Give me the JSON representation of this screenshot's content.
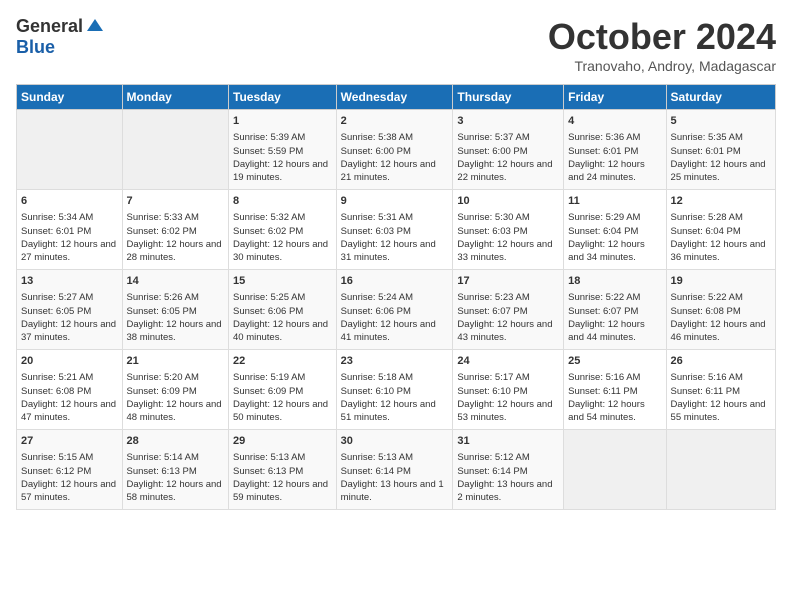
{
  "header": {
    "logo_general": "General",
    "logo_blue": "Blue",
    "month_title": "October 2024",
    "location": "Tranovaho, Androy, Madagascar"
  },
  "days_of_week": [
    "Sunday",
    "Monday",
    "Tuesday",
    "Wednesday",
    "Thursday",
    "Friday",
    "Saturday"
  ],
  "weeks": [
    [
      {
        "day": "",
        "sunrise": "",
        "sunset": "",
        "daylight": ""
      },
      {
        "day": "",
        "sunrise": "",
        "sunset": "",
        "daylight": ""
      },
      {
        "day": "1",
        "sunrise": "Sunrise: 5:39 AM",
        "sunset": "Sunset: 5:59 PM",
        "daylight": "Daylight: 12 hours and 19 minutes."
      },
      {
        "day": "2",
        "sunrise": "Sunrise: 5:38 AM",
        "sunset": "Sunset: 6:00 PM",
        "daylight": "Daylight: 12 hours and 21 minutes."
      },
      {
        "day": "3",
        "sunrise": "Sunrise: 5:37 AM",
        "sunset": "Sunset: 6:00 PM",
        "daylight": "Daylight: 12 hours and 22 minutes."
      },
      {
        "day": "4",
        "sunrise": "Sunrise: 5:36 AM",
        "sunset": "Sunset: 6:01 PM",
        "daylight": "Daylight: 12 hours and 24 minutes."
      },
      {
        "day": "5",
        "sunrise": "Sunrise: 5:35 AM",
        "sunset": "Sunset: 6:01 PM",
        "daylight": "Daylight: 12 hours and 25 minutes."
      }
    ],
    [
      {
        "day": "6",
        "sunrise": "Sunrise: 5:34 AM",
        "sunset": "Sunset: 6:01 PM",
        "daylight": "Daylight: 12 hours and 27 minutes."
      },
      {
        "day": "7",
        "sunrise": "Sunrise: 5:33 AM",
        "sunset": "Sunset: 6:02 PM",
        "daylight": "Daylight: 12 hours and 28 minutes."
      },
      {
        "day": "8",
        "sunrise": "Sunrise: 5:32 AM",
        "sunset": "Sunset: 6:02 PM",
        "daylight": "Daylight: 12 hours and 30 minutes."
      },
      {
        "day": "9",
        "sunrise": "Sunrise: 5:31 AM",
        "sunset": "Sunset: 6:03 PM",
        "daylight": "Daylight: 12 hours and 31 minutes."
      },
      {
        "day": "10",
        "sunrise": "Sunrise: 5:30 AM",
        "sunset": "Sunset: 6:03 PM",
        "daylight": "Daylight: 12 hours and 33 minutes."
      },
      {
        "day": "11",
        "sunrise": "Sunrise: 5:29 AM",
        "sunset": "Sunset: 6:04 PM",
        "daylight": "Daylight: 12 hours and 34 minutes."
      },
      {
        "day": "12",
        "sunrise": "Sunrise: 5:28 AM",
        "sunset": "Sunset: 6:04 PM",
        "daylight": "Daylight: 12 hours and 36 minutes."
      }
    ],
    [
      {
        "day": "13",
        "sunrise": "Sunrise: 5:27 AM",
        "sunset": "Sunset: 6:05 PM",
        "daylight": "Daylight: 12 hours and 37 minutes."
      },
      {
        "day": "14",
        "sunrise": "Sunrise: 5:26 AM",
        "sunset": "Sunset: 6:05 PM",
        "daylight": "Daylight: 12 hours and 38 minutes."
      },
      {
        "day": "15",
        "sunrise": "Sunrise: 5:25 AM",
        "sunset": "Sunset: 6:06 PM",
        "daylight": "Daylight: 12 hours and 40 minutes."
      },
      {
        "day": "16",
        "sunrise": "Sunrise: 5:24 AM",
        "sunset": "Sunset: 6:06 PM",
        "daylight": "Daylight: 12 hours and 41 minutes."
      },
      {
        "day": "17",
        "sunrise": "Sunrise: 5:23 AM",
        "sunset": "Sunset: 6:07 PM",
        "daylight": "Daylight: 12 hours and 43 minutes."
      },
      {
        "day": "18",
        "sunrise": "Sunrise: 5:22 AM",
        "sunset": "Sunset: 6:07 PM",
        "daylight": "Daylight: 12 hours and 44 minutes."
      },
      {
        "day": "19",
        "sunrise": "Sunrise: 5:22 AM",
        "sunset": "Sunset: 6:08 PM",
        "daylight": "Daylight: 12 hours and 46 minutes."
      }
    ],
    [
      {
        "day": "20",
        "sunrise": "Sunrise: 5:21 AM",
        "sunset": "Sunset: 6:08 PM",
        "daylight": "Daylight: 12 hours and 47 minutes."
      },
      {
        "day": "21",
        "sunrise": "Sunrise: 5:20 AM",
        "sunset": "Sunset: 6:09 PM",
        "daylight": "Daylight: 12 hours and 48 minutes."
      },
      {
        "day": "22",
        "sunrise": "Sunrise: 5:19 AM",
        "sunset": "Sunset: 6:09 PM",
        "daylight": "Daylight: 12 hours and 50 minutes."
      },
      {
        "day": "23",
        "sunrise": "Sunrise: 5:18 AM",
        "sunset": "Sunset: 6:10 PM",
        "daylight": "Daylight: 12 hours and 51 minutes."
      },
      {
        "day": "24",
        "sunrise": "Sunrise: 5:17 AM",
        "sunset": "Sunset: 6:10 PM",
        "daylight": "Daylight: 12 hours and 53 minutes."
      },
      {
        "day": "25",
        "sunrise": "Sunrise: 5:16 AM",
        "sunset": "Sunset: 6:11 PM",
        "daylight": "Daylight: 12 hours and 54 minutes."
      },
      {
        "day": "26",
        "sunrise": "Sunrise: 5:16 AM",
        "sunset": "Sunset: 6:11 PM",
        "daylight": "Daylight: 12 hours and 55 minutes."
      }
    ],
    [
      {
        "day": "27",
        "sunrise": "Sunrise: 5:15 AM",
        "sunset": "Sunset: 6:12 PM",
        "daylight": "Daylight: 12 hours and 57 minutes."
      },
      {
        "day": "28",
        "sunrise": "Sunrise: 5:14 AM",
        "sunset": "Sunset: 6:13 PM",
        "daylight": "Daylight: 12 hours and 58 minutes."
      },
      {
        "day": "29",
        "sunrise": "Sunrise: 5:13 AM",
        "sunset": "Sunset: 6:13 PM",
        "daylight": "Daylight: 12 hours and 59 minutes."
      },
      {
        "day": "30",
        "sunrise": "Sunrise: 5:13 AM",
        "sunset": "Sunset: 6:14 PM",
        "daylight": "Daylight: 13 hours and 1 minute."
      },
      {
        "day": "31",
        "sunrise": "Sunrise: 5:12 AM",
        "sunset": "Sunset: 6:14 PM",
        "daylight": "Daylight: 13 hours and 2 minutes."
      },
      {
        "day": "",
        "sunrise": "",
        "sunset": "",
        "daylight": ""
      },
      {
        "day": "",
        "sunrise": "",
        "sunset": "",
        "daylight": ""
      }
    ]
  ]
}
